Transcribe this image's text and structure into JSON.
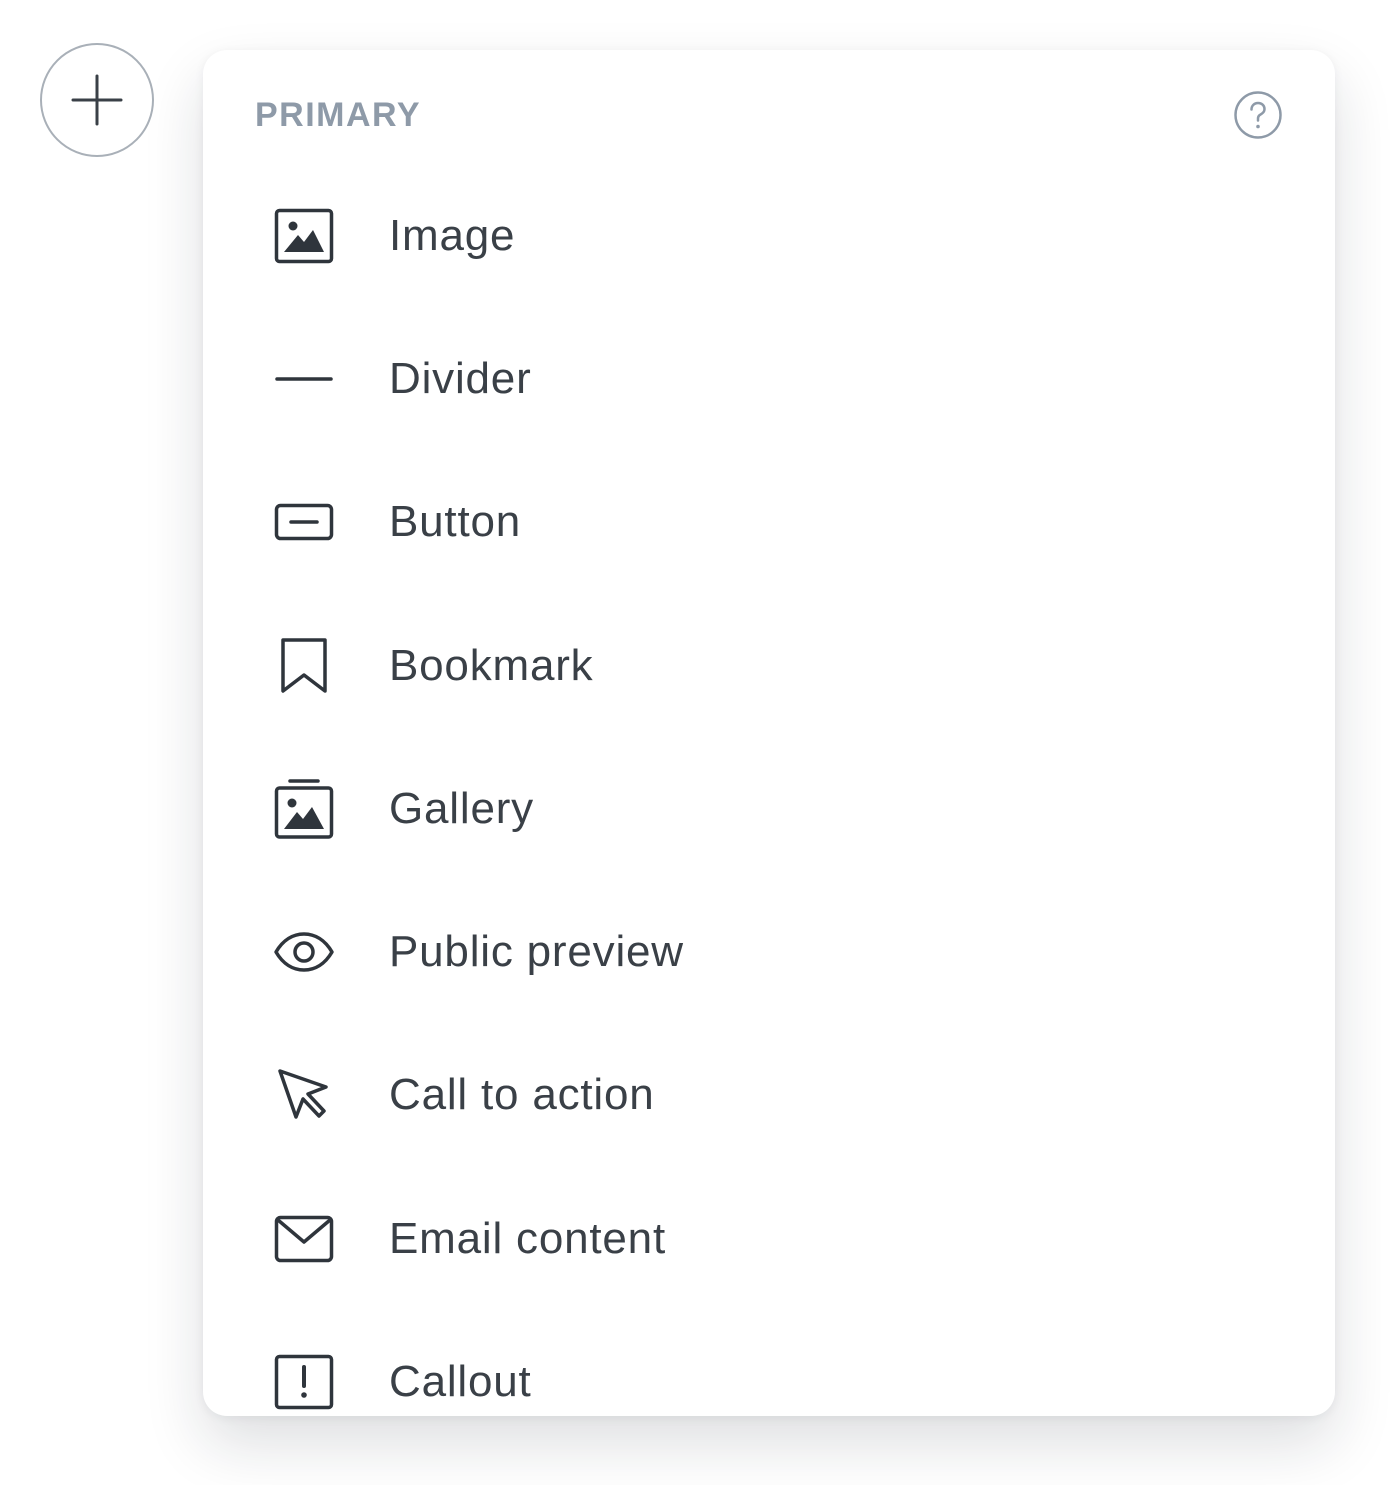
{
  "add_button": {
    "icon": "plus-icon"
  },
  "menu": {
    "section_label": "PRIMARY",
    "help_icon": "question-circle-icon",
    "items": [
      {
        "label": "Image",
        "icon": "image-icon"
      },
      {
        "label": "Divider",
        "icon": "divider-icon"
      },
      {
        "label": "Button",
        "icon": "button-icon"
      },
      {
        "label": "Bookmark",
        "icon": "bookmark-icon"
      },
      {
        "label": "Gallery",
        "icon": "gallery-icon"
      },
      {
        "label": "Public preview",
        "icon": "eye-icon"
      },
      {
        "label": "Call to action",
        "icon": "cursor-icon"
      },
      {
        "label": "Email content",
        "icon": "envelope-icon"
      },
      {
        "label": "Callout",
        "icon": "exclamation-box-icon"
      }
    ]
  },
  "colors": {
    "label_text": "#3a4047",
    "section_label": "#8e9aa8",
    "icon_stroke": "#2f353c",
    "muted_stroke": "#a9b0b8"
  }
}
